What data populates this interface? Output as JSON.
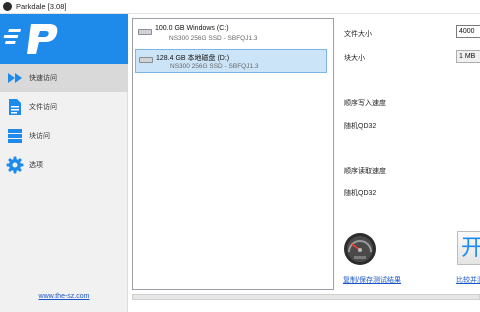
{
  "window": {
    "title": "Parkdale [3.08]"
  },
  "sidebar": {
    "items": [
      {
        "label": "快速访问",
        "icon": "play-arrows-icon",
        "active": true
      },
      {
        "label": "文件访问",
        "icon": "document-icon",
        "active": false
      },
      {
        "label": "块访问",
        "icon": "blocks-icon",
        "active": false
      },
      {
        "label": "选项",
        "icon": "gear-icon",
        "active": false
      }
    ],
    "website": "www.the-sz.com"
  },
  "drives": [
    {
      "name": "100.0 GB Windows (C:)",
      "model": "NS300 256G SSD - SBFQJ1.3",
      "selected": false
    },
    {
      "name": "128.4 GB 本地磁盘 (D:)",
      "model": "NS300 256G SSD - SBFQJ1.3",
      "selected": true
    }
  ],
  "settings": {
    "file_size_label": "文件大小",
    "file_size_value": "4000",
    "block_size_label": "块大小",
    "block_size_value": "1 MB"
  },
  "results": {
    "seq_write_label": "顺序写入速度",
    "rand_write_label": "随机QD32",
    "seq_read_label": "顺序读取速度",
    "rand_read_label": "随机QD32"
  },
  "actions": {
    "copy_results": "复制/保存测试结果",
    "start_button": "开",
    "compare": "比较并测"
  },
  "colors": {
    "accent": "#1e8bea",
    "selection": "#cce4f7",
    "link": "#1a56c8"
  }
}
